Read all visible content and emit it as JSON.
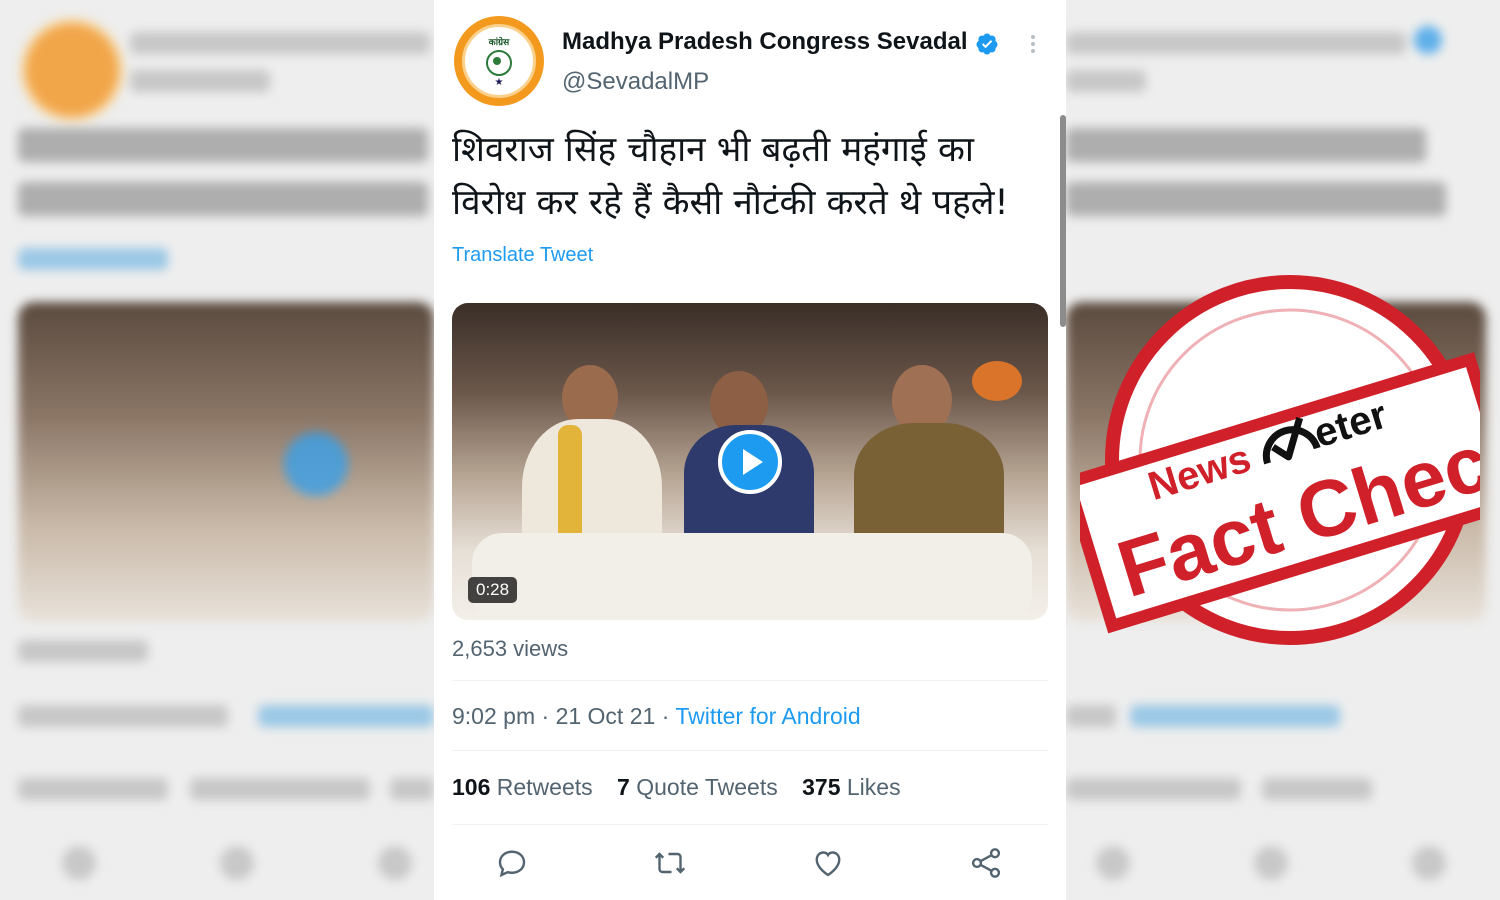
{
  "tweet": {
    "display_name": "Madhya Pradesh Congress Sevadal",
    "handle": "@SevadalMP",
    "text_line1": "शिवराज सिंह चौहान भी बढ़ती महंगाई का",
    "text_line2": "विरोध कर रहे हैं कैसी नौटंकी करते थे पहले!",
    "translate_label": "Translate Tweet",
    "video_duration": "0:28",
    "views": "2,653 views",
    "time": "9:02 pm",
    "date": "21 Oct 21",
    "separator": "·",
    "source": "Twitter for Android",
    "retweets_count": "106",
    "retweets_label": "Retweets",
    "quotes_count": "7",
    "quotes_label": "Quote Tweets",
    "likes_count": "375",
    "likes_label": "Likes"
  },
  "stamp": {
    "brand_news": "News",
    "brand_meter": "eter",
    "label": "Fact Check"
  },
  "icons": [
    "verified-badge-icon",
    "more-options-icon",
    "play-icon",
    "reply-icon",
    "retweet-icon",
    "like-icon",
    "share-icon"
  ],
  "colors": {
    "accent": "#1d9bf0",
    "stamp_red": "#d0202a",
    "text": "#0f1419",
    "secondary_text": "#536471"
  }
}
